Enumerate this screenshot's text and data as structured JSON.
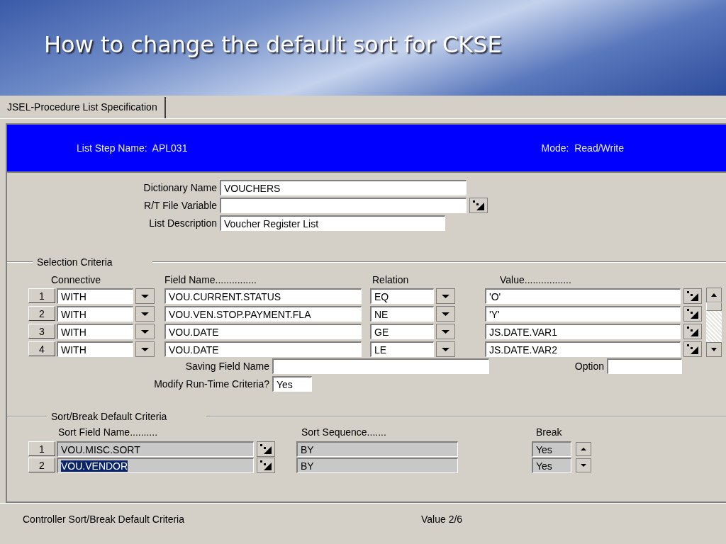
{
  "slide": {
    "title": "How to change the default sort for CKSE"
  },
  "tabs": [
    {
      "label": "JSEL-Procedure List Specification",
      "selected": true
    }
  ],
  "header": {
    "step_name": "List Step Name:  APL031",
    "mode": "Mode:  Read/Write"
  },
  "fields": [
    {
      "label": "Dictionary Name",
      "value": "VOUCHERS",
      "lookup": false
    },
    {
      "label": "R/T File Variable",
      "lookup": true
    },
    {
      "label": "List Description",
      "value": "Voucher Register List",
      "lookup": false
    }
  ],
  "selection": {
    "title": "Selection Criteria",
    "columns": [
      "Connective",
      "Field Name...............",
      "Relation",
      "Value................."
    ],
    "rows": [
      {
        "number": "1",
        "connective": "WITH",
        "field": "VOU.CURRENT.STATUS",
        "relation": "EQ",
        "value": "'O'"
      },
      {
        "number": "2",
        "connective": "WITH",
        "field": "VOU.VEN.STOP.PAYMENT.FLA",
        "relation": "NE",
        "value": "'Y'"
      },
      {
        "number": "3",
        "connective": "WITH",
        "field": "VOU.DATE",
        "relation": "GE",
        "value": "JS.DATE.VAR1"
      },
      {
        "number": "4",
        "connective": "WITH",
        "field": "VOU.DATE",
        "relation": "LE",
        "value": "JS.DATE.VAR2"
      }
    ],
    "saving_field": {
      "label": "Saving Field Name"
    },
    "option": {
      "label": "Option"
    },
    "modify": {
      "label": "Modify Run-Time Criteria?",
      "value": "Yes"
    }
  },
  "sort": {
    "title": "Sort/Break Default Criteria",
    "columns": [
      "Sort Field Name..........",
      "Sort Sequence.......",
      "Break"
    ],
    "rows": [
      {
        "number": "1",
        "field": "VOU.MISC.SORT",
        "sequence": "BY",
        "break": "Yes",
        "selected": false
      },
      {
        "number": "2",
        "field": "VOU.VENDOR",
        "sequence": "BY",
        "break": "Yes",
        "selected": true
      }
    ]
  },
  "status_bar": {
    "message": "Controller Sort/Break Default Criteria",
    "position": "Value 2/6"
  }
}
